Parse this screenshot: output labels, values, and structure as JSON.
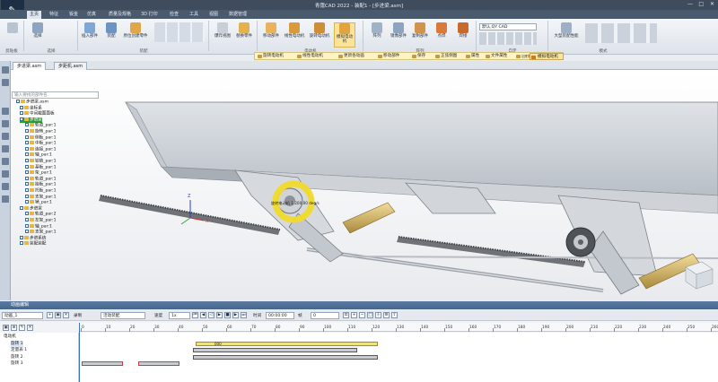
{
  "window": {
    "title": "青霭CAD 2022 - 装配1 - [步进梁.asm]"
  },
  "ribbon_tabs": [
    "主页",
    "特征",
    "钣金",
    "仿真",
    "质量及规格",
    "3D 打印",
    "检查",
    "工具",
    "视图",
    "数据管理"
  ],
  "ribbon": {
    "buttons": [
      {
        "label": "选择"
      },
      {
        "label": "插入部件"
      },
      {
        "label": "装配"
      },
      {
        "label": "原位创建零件"
      },
      {
        "label": "爆炸视图"
      },
      {
        "label": "替换零件"
      },
      {
        "label": "移动部件"
      },
      {
        "label": "线性电动机"
      },
      {
        "label": "旋转电动机"
      },
      {
        "label": "模拟电动机"
      },
      {
        "label": "阵列"
      },
      {
        "label": "镜像部件"
      },
      {
        "label": "复制部件"
      },
      {
        "label": "点焊"
      },
      {
        "label": "焊接"
      },
      {
        "label": "大型装配性能"
      }
    ],
    "groups": [
      "剪贴板",
      "选择",
      "装配",
      "电动机",
      "阵列",
      "自定",
      "模式"
    ],
    "style_select": "默认,QY CAD"
  },
  "motor_toolbar": [
    "旋转电动机",
    "线性电动机",
    "更新各动画",
    "移动部件",
    "保存",
    "正弦侧图",
    "属性",
    "文件属性",
    "出射模型的图纸",
    "模拟电动机"
  ],
  "doc_tabs": [
    "步进梁.asm",
    "步距机.asm"
  ],
  "tree": {
    "filter_placeholder": "输入要找的部件名",
    "items": [
      "步进梁.asm",
      "坐标系",
      "中间截面面板",
      "步进梁",
      "轨道_par:1",
      "旋转_par:1",
      "侧板_par:1",
      "中板_par:1",
      "连接_par:1",
      "轴_par:1",
      "铰链_par:1",
      "基板_par:1",
      "架_par:1",
      "轨道_par:1",
      "挂板_par:1",
      "托板_par:1",
      "支架_par:1",
      "销_par:1",
      "步进梁",
      "轨道_par:2",
      "左架_par:1",
      "轴_par:1",
      "支架_par:1",
      "步进系统",
      "装配装配"
    ]
  },
  "viewport": {
    "motor_badge": "旋转电动机 1  200.00 deg/s"
  },
  "bottom": {
    "panel_title": "动画编辑",
    "animation_name": "动画_1",
    "mode_label": "录制",
    "mode_value": "活动装配",
    "speed_label": "速度",
    "speed_value": "1x",
    "time_label": "时间",
    "time_value": "00:00:00",
    "frame_label": "帧",
    "frame_value": "0",
    "ruler_ticks": [
      "0",
      "10",
      "20",
      "30",
      "40",
      "50",
      "60",
      "70",
      "80",
      "90",
      "100",
      "110",
      "120",
      "130",
      "140",
      "150",
      "160",
      "170",
      "180",
      "190",
      "200",
      "210",
      "220",
      "230",
      "240",
      "250",
      "260"
    ],
    "tracks": [
      {
        "name": "电动机",
        "label": ""
      },
      {
        "name": "旋转 1",
        "label": "000"
      },
      {
        "name": "定量表 1",
        "label": ""
      },
      {
        "name": "旋转 2",
        "label": ""
      },
      {
        "name": "旋转 3",
        "label": ""
      }
    ]
  },
  "colors": {
    "accent": "#2f9a3a",
    "selection": "#f2e27a",
    "titlebar": "#3e4c5e"
  }
}
